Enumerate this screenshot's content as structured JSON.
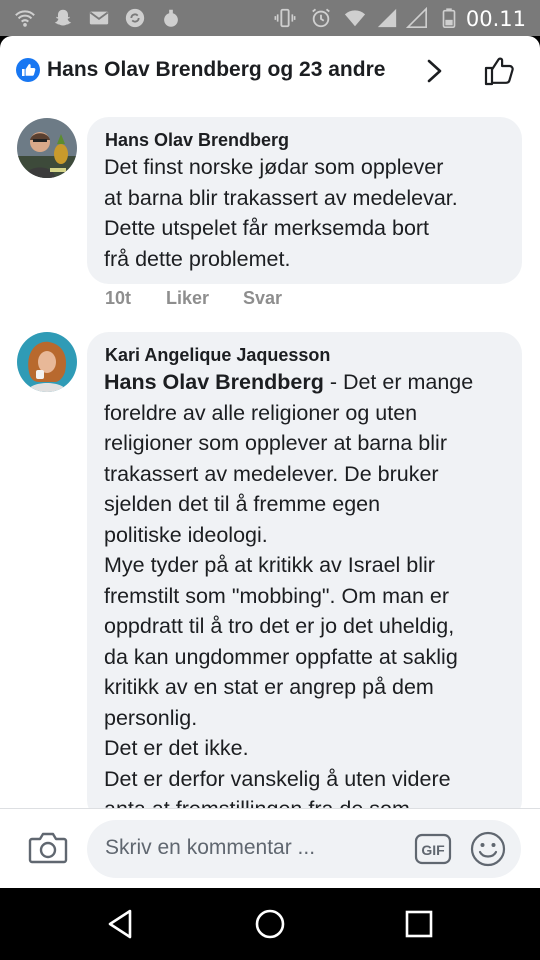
{
  "status_bar": {
    "time": "00.11"
  },
  "header": {
    "title": "Hans Olav Brendberg og 23 andre"
  },
  "comments": [
    {
      "author": "Hans Olav Brendberg",
      "lines": [
        "Det finst norske jødar som opplever",
        "at barna blir trakassert av medelevar.",
        "Dette utspelet får merksemda bort",
        "frå dette problemet."
      ],
      "time": "10t",
      "like_label": "Liker",
      "reply_label": "Svar"
    },
    {
      "author": "Kari Angelique Jaquesson",
      "mention": "Hans Olav Brendberg",
      "first_line_rest": " - Det er mange",
      "lines": [
        "foreldre av alle religioner og uten",
        "religioner som opplever at barna blir",
        "trakassert av medelever. De bruker",
        "sjelden det til å fremme egen",
        "politiske ideologi.",
        "Mye tyder på at kritikk av Israel blir",
        "fremstilt som \"mobbing\". Om man er",
        "oppdratt til å tro det er jo det uheldig,",
        "da kan ungdommer oppfatte at saklig",
        "kritikk av en stat er angrep på dem",
        "personlig.",
        "Det er det ikke.",
        "Det er derfor vanskelig å uten videre",
        "anta at fremstillingen fra de som"
      ]
    }
  ],
  "composer": {
    "placeholder": "Skriv en kommentar ...",
    "gif_label": "GIF"
  },
  "colors": {
    "accent": "#1877f2",
    "bubble": "#f0f2f5",
    "meta_text": "#8e8e8e"
  }
}
